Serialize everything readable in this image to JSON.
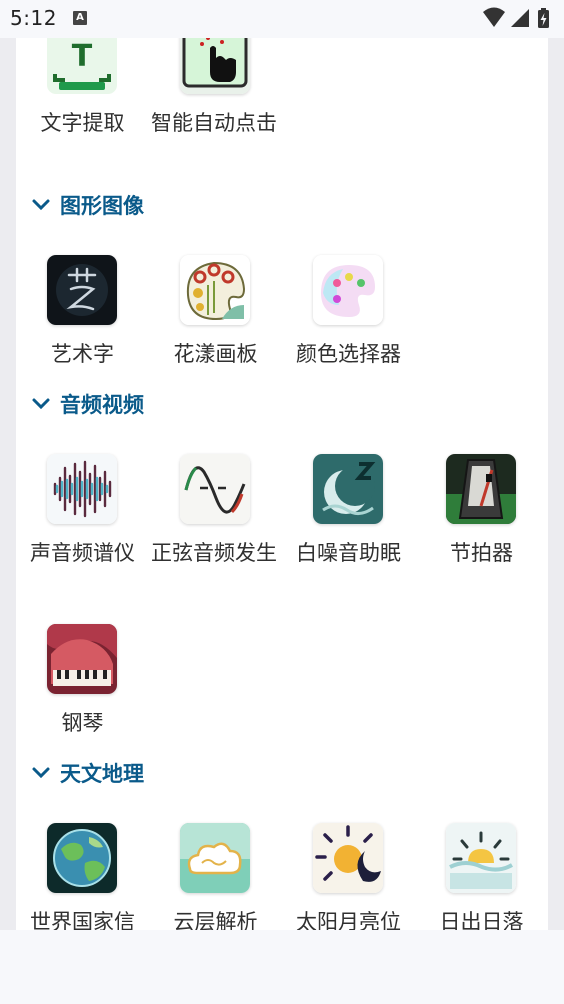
{
  "status_bar": {
    "time": "5:12",
    "notification_letter": "A"
  },
  "sections": [
    {
      "title": null,
      "tools": [
        {
          "label": "文字提取",
          "icon": "text-extract-icon"
        },
        {
          "label": "智能自动点击",
          "icon": "auto-click-icon"
        }
      ]
    },
    {
      "title": "图形图像",
      "tools": [
        {
          "label": "艺术字",
          "icon": "art-text-icon"
        },
        {
          "label": "花漾画板",
          "icon": "drawing-board-icon"
        },
        {
          "label": "颜色选择器",
          "icon": "color-picker-icon"
        }
      ]
    },
    {
      "title": "音频视频",
      "tools": [
        {
          "label": "声音频谱仪",
          "icon": "spectrum-analyzer-icon"
        },
        {
          "label": "正弦音频发生",
          "icon": "sine-generator-icon"
        },
        {
          "label": "白噪音助眠",
          "icon": "white-noise-icon"
        },
        {
          "label": "节拍器",
          "icon": "metronome-icon"
        },
        {
          "label": "钢琴",
          "icon": "piano-icon"
        }
      ]
    },
    {
      "title": "天文地理",
      "tools": [
        {
          "label": "世界国家信",
          "icon": "globe-icon"
        },
        {
          "label": "云层解析",
          "icon": "cloud-icon"
        },
        {
          "label": "太阳月亮位",
          "icon": "sun-moon-icon"
        },
        {
          "label": "日出日落",
          "icon": "sunrise-icon"
        }
      ]
    }
  ]
}
